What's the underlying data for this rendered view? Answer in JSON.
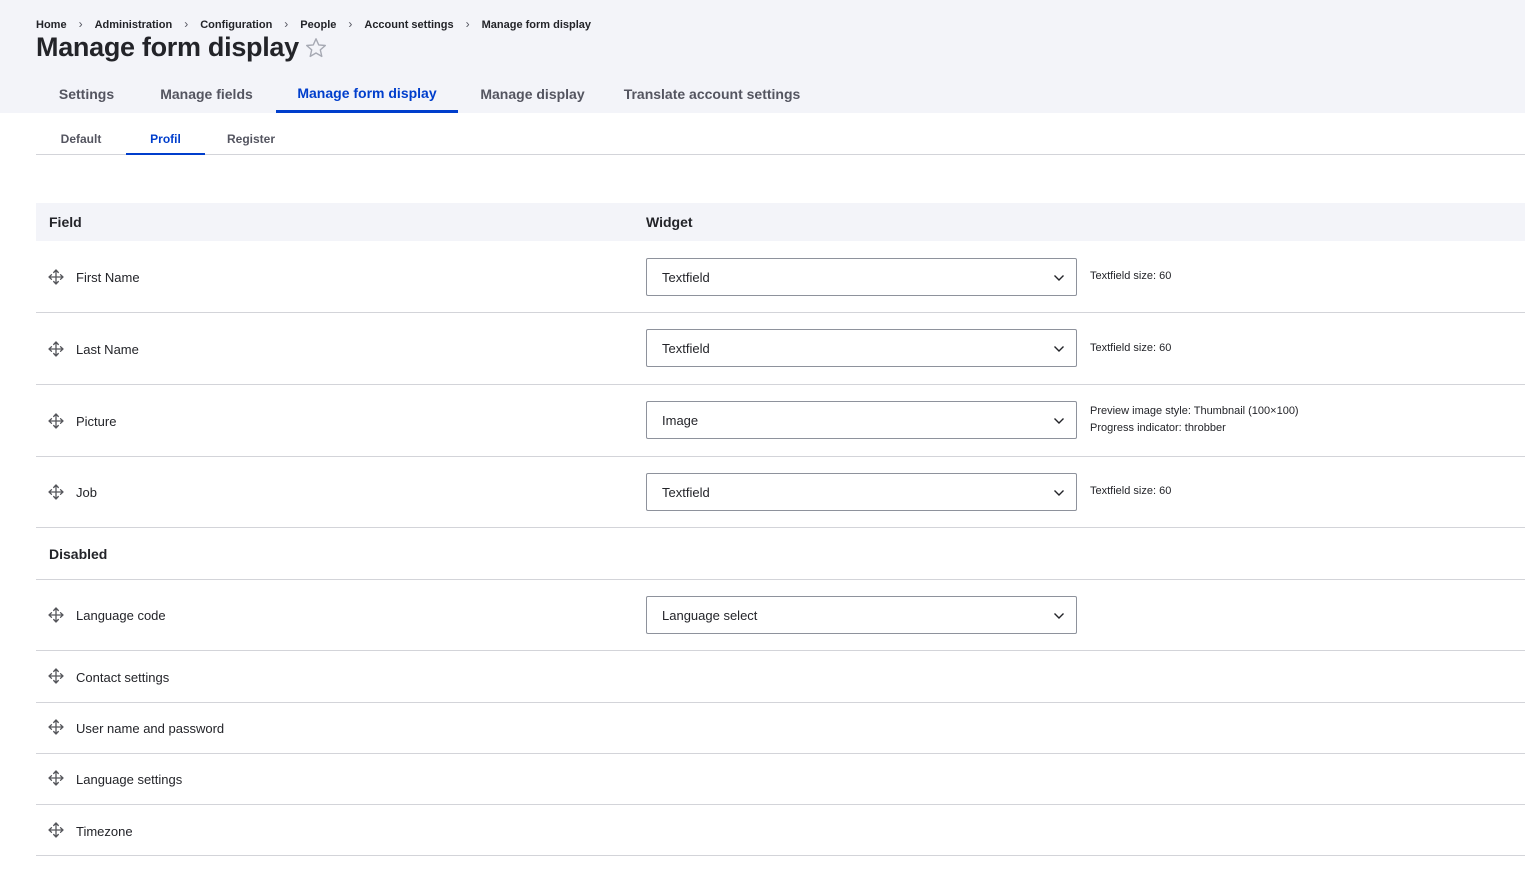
{
  "breadcrumb": [
    "Home",
    "Administration",
    "Configuration",
    "People",
    "Account settings",
    "Manage form display"
  ],
  "page": {
    "title": "Manage form display",
    "favorite_icon": "star-outline-icon"
  },
  "primary_tabs": [
    {
      "label": "Settings",
      "active": false
    },
    {
      "label": "Manage fields",
      "active": false
    },
    {
      "label": "Manage form display",
      "active": true
    },
    {
      "label": "Manage display",
      "active": false
    },
    {
      "label": "Translate account settings",
      "active": false
    }
  ],
  "secondary_tabs": [
    {
      "label": "Default",
      "active": false
    },
    {
      "label": "Profil",
      "active": true
    },
    {
      "label": "Register",
      "active": false
    }
  ],
  "table": {
    "headers": {
      "field": "Field",
      "widget": "Widget"
    },
    "enabled_rows": [
      {
        "label": "First Name",
        "widget": "Textfield",
        "summary": [
          "Textfield size: 60"
        ]
      },
      {
        "label": "Last Name",
        "widget": "Textfield",
        "summary": [
          "Textfield size: 60"
        ]
      },
      {
        "label": "Picture",
        "widget": "Image",
        "summary": [
          "Preview image style: Thumbnail (100×100)",
          "Progress indicator: throbber"
        ]
      },
      {
        "label": "Job",
        "widget": "Textfield",
        "summary": [
          "Textfield size: 60"
        ]
      }
    ],
    "disabled_title": "Disabled",
    "disabled_rows": [
      {
        "label": "Language code",
        "widget": "Language select"
      },
      {
        "label": "Contact settings"
      },
      {
        "label": "User name and password"
      },
      {
        "label": "Language settings"
      },
      {
        "label": "Timezone"
      }
    ]
  },
  "colors": {
    "accent": "#003ecc",
    "header_bg": "#f3f4f9",
    "border": "#d3d4d9"
  }
}
